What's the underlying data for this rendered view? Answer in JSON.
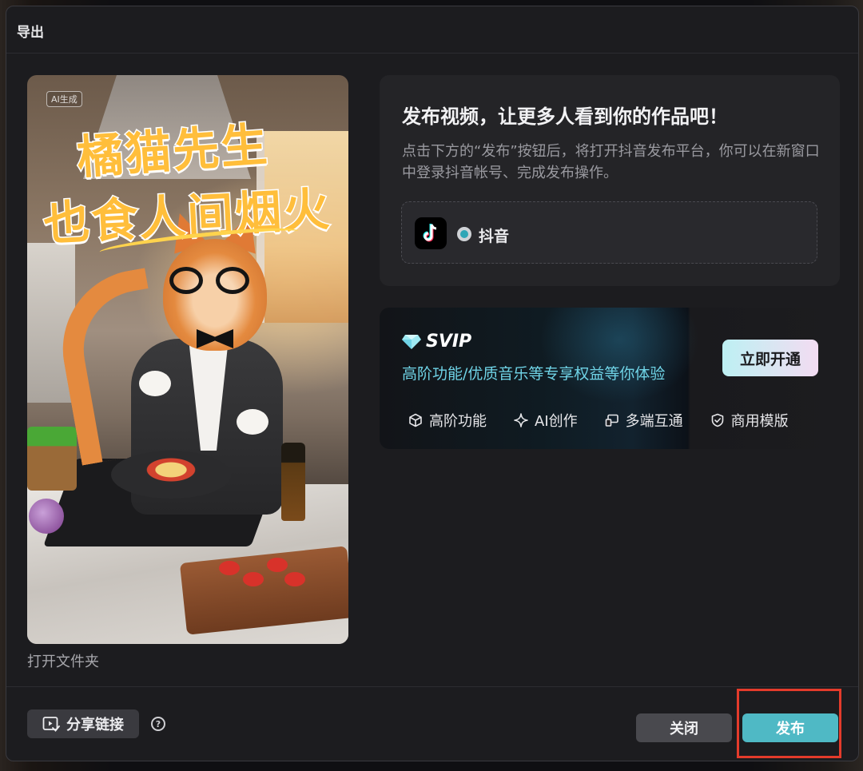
{
  "dialog": {
    "title": "导出"
  },
  "preview": {
    "ai_badge": "AI生成",
    "poster_line1": "橘猫先生",
    "poster_line2": "也食人间烟火",
    "open_folder_label": "打开文件夹"
  },
  "publish": {
    "heading": "发布视频，让更多人看到你的作品吧！",
    "description": "点击下方的“发布”按钮后，将打开抖音发布平台，你可以在新窗口中登录抖音帐号、完成发布操作。",
    "platform": {
      "name": "抖音",
      "selected": true
    }
  },
  "svip": {
    "brand": "SVIP",
    "subtitle": "高阶功能/优质音乐等专享权益等你体验",
    "cta_label": "立即开通",
    "features": [
      {
        "icon": "cube-icon",
        "label": "高阶功能"
      },
      {
        "icon": "sparkle-icon",
        "label": "AI创作"
      },
      {
        "icon": "devices-icon",
        "label": "多端互通"
      },
      {
        "icon": "shield-check-icon",
        "label": "商用模版"
      }
    ],
    "accent_color": "#6fd3e6"
  },
  "footer": {
    "share_label": "分享链接",
    "help_glyph": "?",
    "close_label": "关闭",
    "publish_label": "发布",
    "publish_color": "#4fb9c5",
    "highlight_color": "#e43b2b"
  }
}
